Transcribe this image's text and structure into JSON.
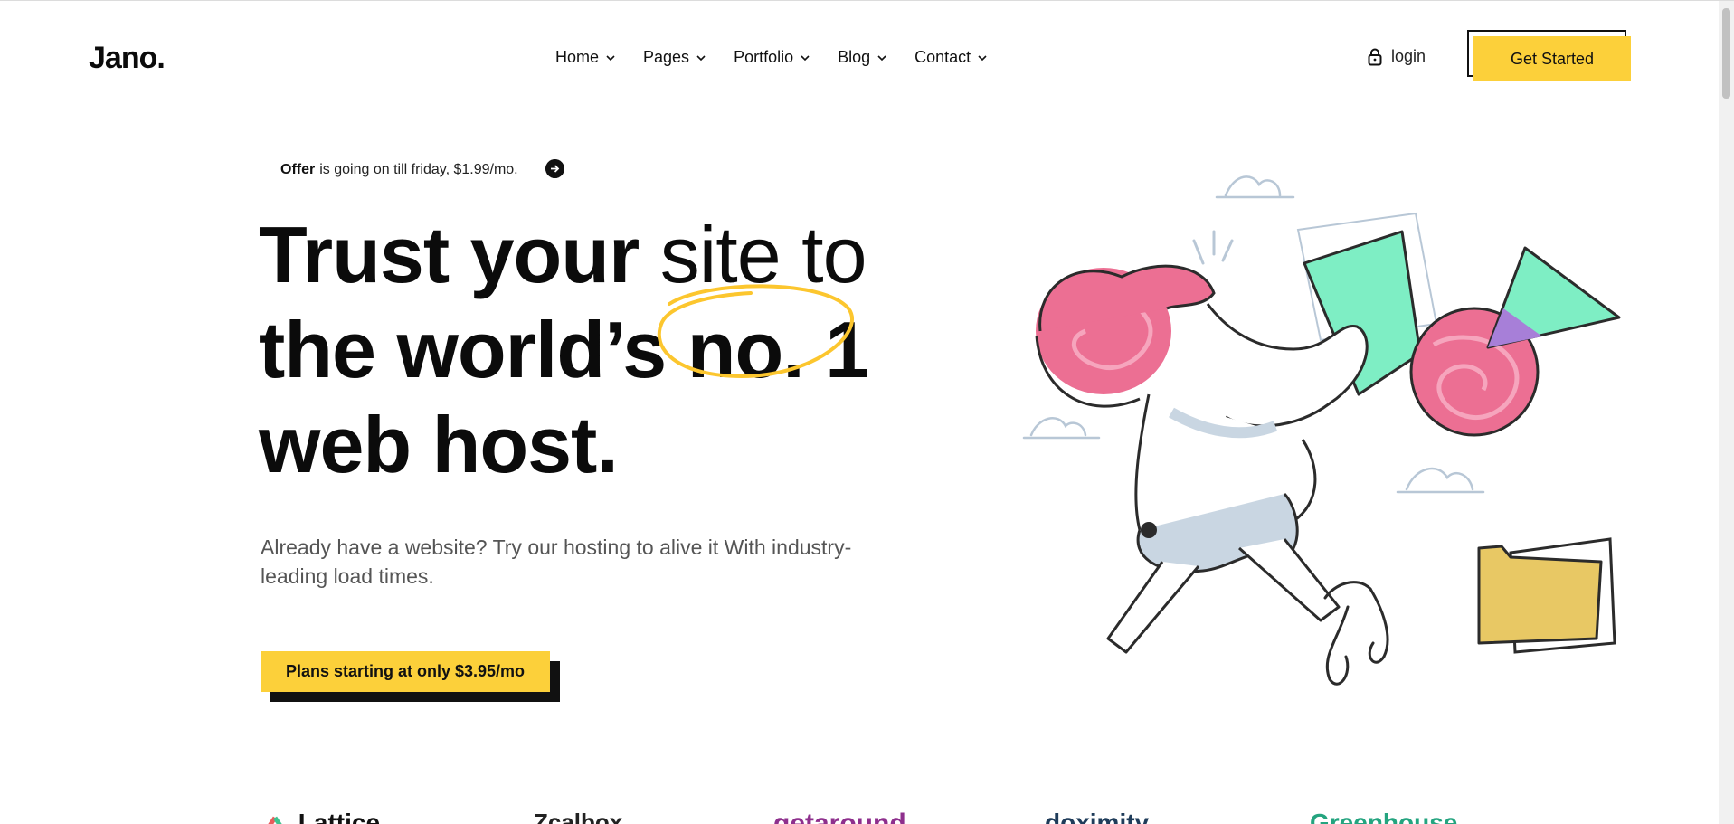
{
  "header": {
    "logo": "Jano.",
    "nav": [
      {
        "label": "Home"
      },
      {
        "label": "Pages"
      },
      {
        "label": "Portfolio"
      },
      {
        "label": "Blog"
      },
      {
        "label": "Contact"
      }
    ],
    "login_label": "login",
    "cta_label": "Get Started"
  },
  "hero": {
    "offer_bold": "Offer",
    "offer_text": "is going on till friday, $1.99/mo.",
    "headline_line1_a": "Trust your",
    "headline_line1_b": "site to",
    "headline_line2_a": "the world’s",
    "headline_line2_b": "no. 1",
    "headline_line3": "web host.",
    "subtext": "Already have a website? Try our hosting to alive it With industry-leading load times.",
    "plans_label": "Plans starting at only $3.95/mo"
  },
  "brands": {
    "lattice": "Lattice",
    "second": "Zcalbox",
    "getaround": "getaround",
    "doximity": "doximity",
    "fifth": "Greenhouse"
  },
  "colors": {
    "accent": "#fcd03a",
    "text": "#0b0b0b",
    "pink": "#ec6f93",
    "mint": "#7eeec4",
    "purple": "#a77fd8",
    "folder": "#e8c864"
  }
}
